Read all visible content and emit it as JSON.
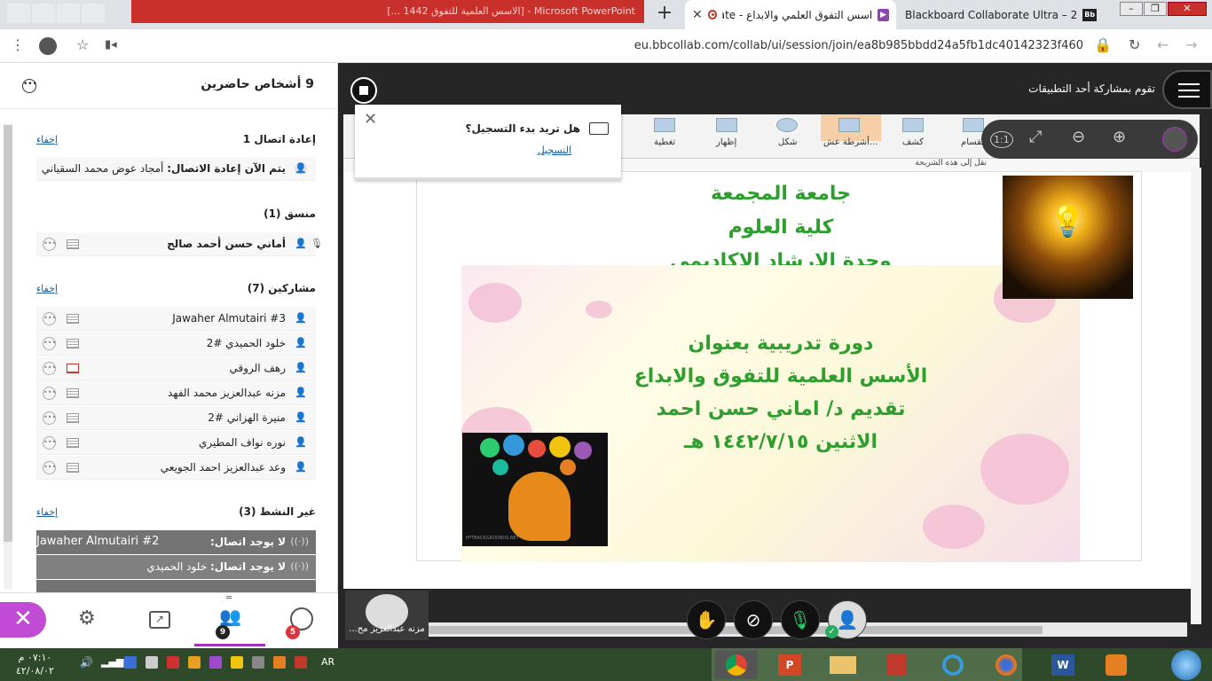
{
  "browser": {
    "tabs": [
      {
        "label": "Microsoft PowerPoint - [الاسس العلمية للتفوق 1442 ...]",
        "state": "background"
      },
      {
        "label": "اسس التفوق العلمي والابداع - orate",
        "state": "active"
      },
      {
        "label": "Blackboard Collaborate Ultra – 2",
        "state": "inactive"
      }
    ],
    "new_tab_label": "+",
    "tab_close_label": "✕",
    "url": "eu.bbcollab.com/collab/ui/session/join/ea8b985bbdd24a5fb1dc40142323f460",
    "window_buttons": [
      "–",
      "❐",
      "✕"
    ]
  },
  "panel": {
    "title": "9 أشخاص حاضرين",
    "hide_label": "إخفاء",
    "sections": {
      "reconnect": {
        "title": "إعادة اتصال 1",
        "row_label": "يتم الآن إعادة الاتصال:",
        "row_name": "أمجاد عوض محمد السقياني"
      },
      "moderator": {
        "title": "منسق (1)",
        "name": "أماني حسن أحمد صالح"
      },
      "participants": {
        "title": "مشاركين (7)",
        "names": [
          "Jawaher Almutairi #3",
          "خلود الحميدي #2",
          "رهف الروقي",
          "مزنه عبدالعزيز محمد الفهد",
          "منيرة الهزاني #2",
          "نوره نواف المطيري",
          "وعد عبدالعزيز احمد الجويعي"
        ]
      },
      "inactive": {
        "title": "غير النشط (3)",
        "no_conn_label": "لا يوجد اتصال:",
        "names": [
          "Jawaher Almutairi #2",
          "خلود الحميدي"
        ]
      }
    },
    "bottom": {
      "people_count": "9",
      "chat_count": "5"
    }
  },
  "session": {
    "share_label": "تقوم بمشاركة أحد التطبيقات",
    "record_prompt": {
      "question": "هل تريد بدء التسجيل؟",
      "link": "التسجيل"
    },
    "user_label": "مزنه عبدالعزيز مح...",
    "zoom_labels": [
      "1:1"
    ]
  },
  "ppt": {
    "ribbon_items": [
      "انقسام",
      "كشف",
      "أشرطة عش...",
      "شكل",
      "إظهار",
      "تغطية"
    ],
    "status_hint": "نقل إلى هذه الشريحة",
    "slide": {
      "title_lines": [
        "جامعة المجمعة",
        "كلية العلوم",
        "وحدة الارشاد الاكاديمي"
      ],
      "body_lines": [
        "دورة تدريبية بعنوان",
        "الأسس العلمية للتفوق والابداع",
        "تقديم د/ اماني حسن احمد",
        "الاثنين ١٤٤٢/٧/١٥ هـ"
      ],
      "footer": "PPTBACKGROUNDS.NET"
    }
  },
  "taskbar": {
    "time": "٠٧:١٠ م",
    "date": "٤٢/٠٨/٠٢",
    "lang": "AR"
  },
  "colors": {
    "accent": "#a034b8",
    "slide_green": "#2e9e2e",
    "badge_red": "#d9363e",
    "dark_bg": "#262626"
  }
}
